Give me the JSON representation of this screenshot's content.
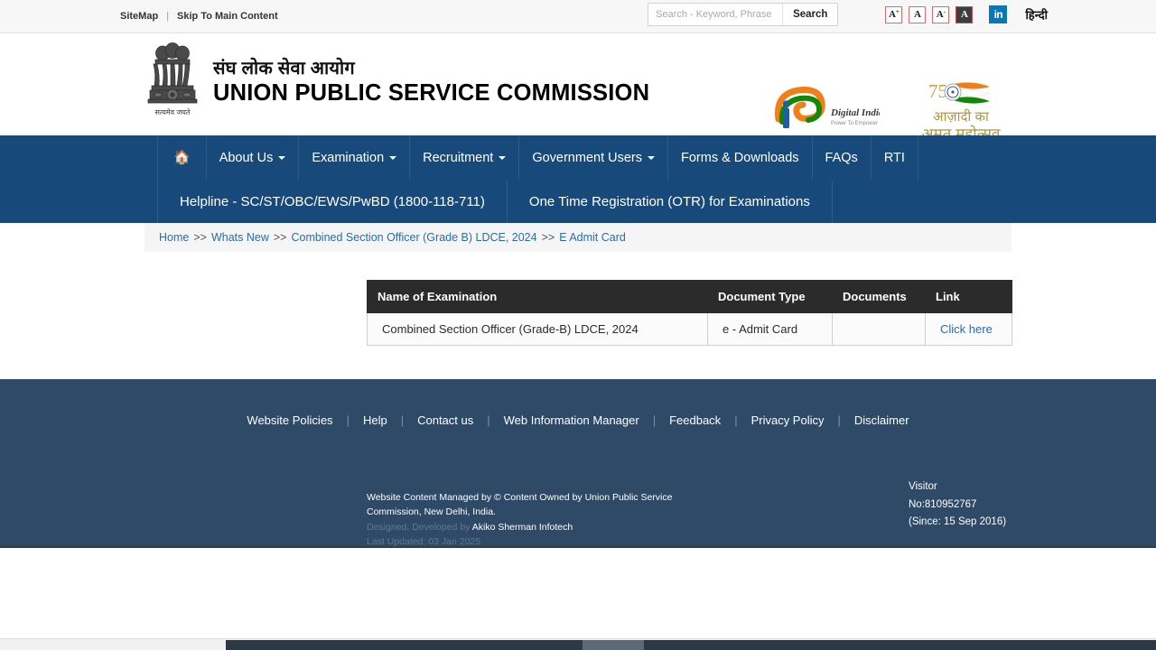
{
  "topbar": {
    "sitemap_label": "SiteMap",
    "separator": "|",
    "skip_label": "Skip To Main Content",
    "search": {
      "placeholder": "Search - Keyword, Phrase",
      "value": "",
      "button_label": "Search"
    },
    "accessibility": [
      {
        "name": "increase-font",
        "label": "A",
        "sup": "+"
      },
      {
        "name": "normal-font",
        "label": "A",
        "sup": ""
      },
      {
        "name": "decrease-font",
        "label": "A",
        "sup": "-"
      },
      {
        "name": "high-contrast",
        "label": "A",
        "sup": ""
      }
    ],
    "linkedin_label": "in",
    "hindi_label": "हिन्दी"
  },
  "header": {
    "title_hindi": "संघ लोक सेवा आयोग",
    "title_english": "UNION PUBLIC SERVICE COMMISSION",
    "emblem_motto": "सत्यमेव जयते",
    "digital_india": {
      "name": "Digital India",
      "tagline": "Power To Empower"
    },
    "amrit_mahotsav": {
      "number": "75",
      "line1": "आज़ादी का",
      "line2": "अमृत महोत्सव"
    }
  },
  "nav": {
    "home_icon": "⌂",
    "primary": [
      {
        "label": "About Us",
        "has_caret": true
      },
      {
        "label": "Examination",
        "has_caret": true
      },
      {
        "label": "Recruitment",
        "has_caret": true
      },
      {
        "label": "Government Users",
        "has_caret": true
      },
      {
        "label": "Forms & Downloads",
        "has_caret": false
      },
      {
        "label": "FAQs",
        "has_caret": false
      },
      {
        "label": "RTI",
        "has_caret": false
      }
    ],
    "secondary": [
      {
        "label": "Helpline - SC/ST/OBC/EWS/PwBD (1800-118-711)"
      },
      {
        "label": "One Time Registration (OTR) for Examinations"
      }
    ]
  },
  "breadcrumb": {
    "separator": ">>",
    "items": [
      {
        "label": "Home"
      },
      {
        "label": "Whats New"
      },
      {
        "label": "Combined Section Officer (Grade B) LDCE, 2024"
      },
      {
        "label": "E Admit Card"
      }
    ]
  },
  "table": {
    "columns": [
      "Name of Examination",
      "Document Type",
      "Documents",
      "Link"
    ],
    "rows": [
      {
        "name": "Combined Section Officer (Grade-B) LDCE, 2024",
        "document_type": "e - Admit Card",
        "documents": "",
        "link_label": "Click here"
      }
    ]
  },
  "footer": {
    "links": [
      "Website Policies",
      "Help",
      "Contact us",
      "Web Information Manager",
      "Feedback",
      "Privacy Policy",
      "Disclaimer"
    ],
    "separator": "|",
    "content_managed": "Website Content Managed by © Content Owned by Union Public Service Commission, New Delhi, India.",
    "designed_prefix": "Designed, Developed by ",
    "designed_by": "Akiko Sherman Infotech",
    "last_updated": "Last Updated: 03 Jan 2025",
    "visitor_label": "Visitor",
    "visitor_count": "No:810952767",
    "visitor_since": "(Since: 15 Sep 2016)"
  },
  "colors": {
    "nav_blue": "#17497b",
    "footer_blue": "#2e4a66",
    "link_blue": "#2c6ca8",
    "table_header": "#2b2b2b",
    "accent_red": "#e06a6a",
    "linkedin_blue": "#0d76b5",
    "saffron": "#f07f1a",
    "green": "#138808"
  }
}
